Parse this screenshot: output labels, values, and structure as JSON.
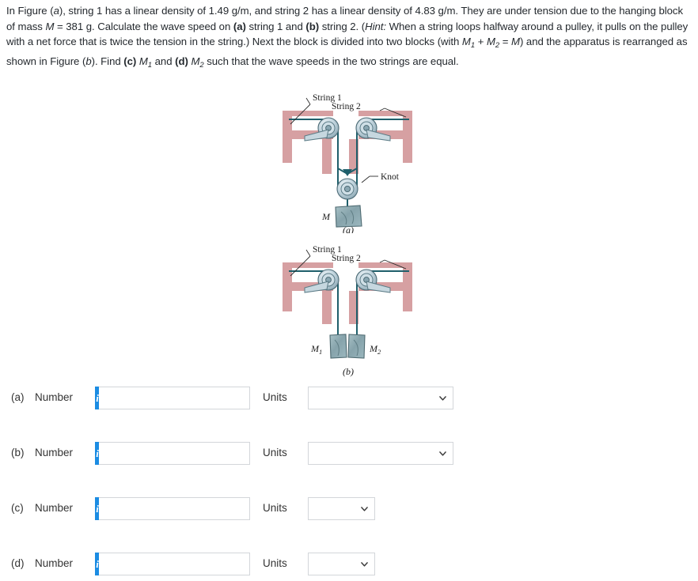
{
  "problem": {
    "paragraph_parts": [
      {
        "t": "In Figure (",
        "s": "n"
      },
      {
        "t": "a",
        "s": "i"
      },
      {
        "t": "), string 1 has a linear density of 1.49 g/m, and string 2 has a linear density of 4.83 g/m. They are under tension due to the hanging block of mass ",
        "s": "n"
      },
      {
        "t": "M",
        "s": "i"
      },
      {
        "t": " = 381 g. Calculate the wave speed on ",
        "s": "n"
      },
      {
        "t": "(a)",
        "s": "b"
      },
      {
        "t": " string 1 and ",
        "s": "n"
      },
      {
        "t": "(b)",
        "s": "b"
      },
      {
        "t": " string 2. (",
        "s": "n"
      },
      {
        "t": "Hint:",
        "s": "i"
      },
      {
        "t": " When a string loops halfway around a pulley, it pulls on the pulley with a net force that is twice the tension in the string.) Next the block is divided into two blocks (with ",
        "s": "n"
      },
      {
        "t": "M",
        "s": "i"
      },
      {
        "t": "1",
        "s": "sub"
      },
      {
        "t": " + ",
        "s": "n"
      },
      {
        "t": "M",
        "s": "i"
      },
      {
        "t": "2",
        "s": "sub"
      },
      {
        "t": " = ",
        "s": "n"
      },
      {
        "t": "M",
        "s": "i"
      },
      {
        "t": ") and the apparatus is rearranged as shown in Figure (",
        "s": "n"
      },
      {
        "t": "b",
        "s": "i"
      },
      {
        "t": "). Find ",
        "s": "n"
      },
      {
        "t": "(c)",
        "s": "b"
      },
      {
        "t": "  ",
        "s": "n"
      },
      {
        "t": "M",
        "s": "i"
      },
      {
        "t": "1",
        "s": "sub"
      },
      {
        "t": " and ",
        "s": "n"
      },
      {
        "t": "(d)",
        "s": "b"
      },
      {
        "t": "  ",
        "s": "n"
      },
      {
        "t": "M",
        "s": "i"
      },
      {
        "t": "2",
        "s": "sub"
      },
      {
        "t": " such that the wave speeds in the two strings are equal.",
        "s": "n"
      }
    ],
    "plain": "In Figure (a), string 1 has a linear density of 1.49 g/m, and string 2 has a linear density of 4.83 g/m. They are under tension due to the hanging block of mass M = 381 g. Calculate the wave speed on (a) string 1 and (b) string 2. (Hint: When a string loops halfway around a pulley, it pulls on the pulley with a net force that is twice the tension in the string.) Next the block is divided into two blocks (with M1 + M2 = M) and the apparatus is rearranged as shown in Figure (b). Find (c) M1 and (d) M2 such that the wave speeds in the two strings are equal."
  },
  "figures": [
    {
      "id": "figure-a",
      "caption": "(a)",
      "labels": {
        "string1": "String 1",
        "string2": "String 2",
        "knot": "Knot",
        "mass": "M"
      }
    },
    {
      "id": "figure-b",
      "caption": "(b)",
      "labels": {
        "string1": "String 1",
        "string2": "String 2",
        "mass1": "M",
        "mass1_sub": "1",
        "mass2": "M",
        "mass2_sub": "2"
      }
    }
  ],
  "colors": {
    "frame_pink": "#d6a0a2",
    "frame_pink_dark": "#c08d8f",
    "string_teal": "#1f5f6b",
    "pulley_fill": "#b8ccd6",
    "pulley_light": "#d6e2e8",
    "block_fill": "#9fbac0",
    "info_blue": "#1b8ce3",
    "border_grey": "#d3d6da",
    "text": "#24292e"
  },
  "answers": {
    "rows": [
      {
        "letter": "(a)",
        "number_label": "Number",
        "info_icon": "info-icon",
        "info_glyph": "i",
        "value": "",
        "placeholder": "",
        "units_label": "Units",
        "units_value": "",
        "units_width": "wide",
        "chevron_icon": "chevron-down-icon"
      },
      {
        "letter": "(b)",
        "number_label": "Number",
        "info_icon": "info-icon",
        "info_glyph": "i",
        "value": "",
        "placeholder": "",
        "units_label": "Units",
        "units_value": "",
        "units_width": "wide",
        "chevron_icon": "chevron-down-icon"
      },
      {
        "letter": "(c)",
        "number_label": "Number",
        "info_icon": "info-icon",
        "info_glyph": "i",
        "value": "",
        "placeholder": "",
        "units_label": "Units",
        "units_value": "",
        "units_width": "narrow",
        "chevron_icon": "chevron-down-icon"
      },
      {
        "letter": "(d)",
        "number_label": "Number",
        "info_icon": "info-icon",
        "info_glyph": "i",
        "value": "",
        "placeholder": "",
        "units_label": "Units",
        "units_value": "",
        "units_width": "narrow",
        "chevron_icon": "chevron-down-icon"
      }
    ]
  }
}
